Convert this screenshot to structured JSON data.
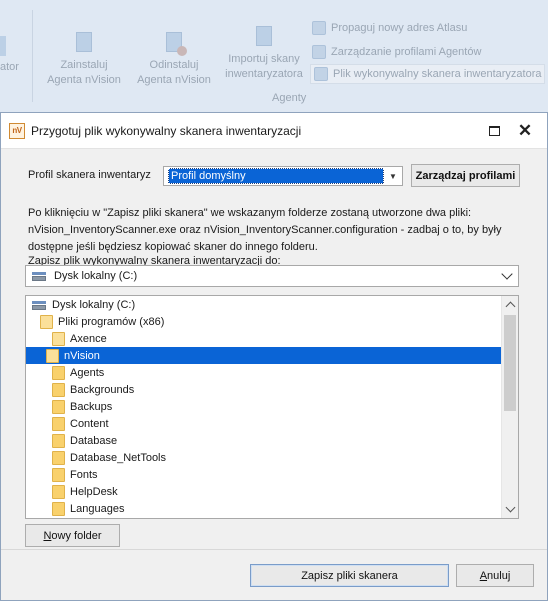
{
  "ribbon": {
    "left_label": "ator",
    "buttons": [
      {
        "line1": "Zainstaluj",
        "line2": "Agenta nVision"
      },
      {
        "line1": "Odinstaluj",
        "line2": "Agenta nVision"
      },
      {
        "line1": "Importuj skany",
        "line2": "inwentaryzatora"
      }
    ],
    "small_items": [
      "Propaguj nowy adres Atlasu",
      "Zarządzanie profilami Agentów",
      "Plik wykonywalny skanera inwentaryzatora"
    ],
    "group_label": "Agenty"
  },
  "dialog": {
    "app_icon_text": "nV",
    "title": "Przygotuj plik wykonywalny skanera inwentaryzacji",
    "profile_label": "Profil skanera inwentaryz",
    "profile_value": "Profil domyślny",
    "manage_profiles_button": "Zarządzaj profilami",
    "description": "Po kliknięciu w \"Zapisz pliki skanera\" we wskazanym folderze zostaną utworzone dwa pliki: nVision_InventoryScanner.exe oraz nVision_InventoryScanner.configuration - zadbaj o to, by były dostępne jeśli będziesz kopiować skaner do innego folderu.",
    "save_to_label": "Zapisz plik wykonywalny skanera inwentaryzacji do:",
    "drive_value": "Dysk lokalny (C:)",
    "tree": [
      {
        "label": "Dysk lokalny (C:)",
        "level": 0,
        "kind": "drive"
      },
      {
        "label": "Pliki programów (x86)",
        "level": 1,
        "kind": "folder"
      },
      {
        "label": "Axence",
        "level": 2,
        "kind": "folder"
      },
      {
        "label": "nVision",
        "level": 3,
        "kind": "folder",
        "selected": true
      },
      {
        "label": "Agents",
        "level": 4,
        "kind": "folder"
      },
      {
        "label": "Backgrounds",
        "level": 4,
        "kind": "folder"
      },
      {
        "label": "Backups",
        "level": 4,
        "kind": "folder"
      },
      {
        "label": "Content",
        "level": 4,
        "kind": "folder"
      },
      {
        "label": "Database",
        "level": 4,
        "kind": "folder"
      },
      {
        "label": "Database_NetTools",
        "level": 4,
        "kind": "folder"
      },
      {
        "label": "Fonts",
        "level": 4,
        "kind": "folder"
      },
      {
        "label": "HelpDesk",
        "level": 4,
        "kind": "folder"
      },
      {
        "label": "Languages",
        "level": 4,
        "kind": "folder"
      }
    ],
    "new_folder_prefix": "N",
    "new_folder_rest": "owy folder",
    "save_button": "Zapisz pliki skanera",
    "cancel_prefix": "A",
    "cancel_rest": "nuluj",
    "accent_color": "#0a64d6"
  }
}
